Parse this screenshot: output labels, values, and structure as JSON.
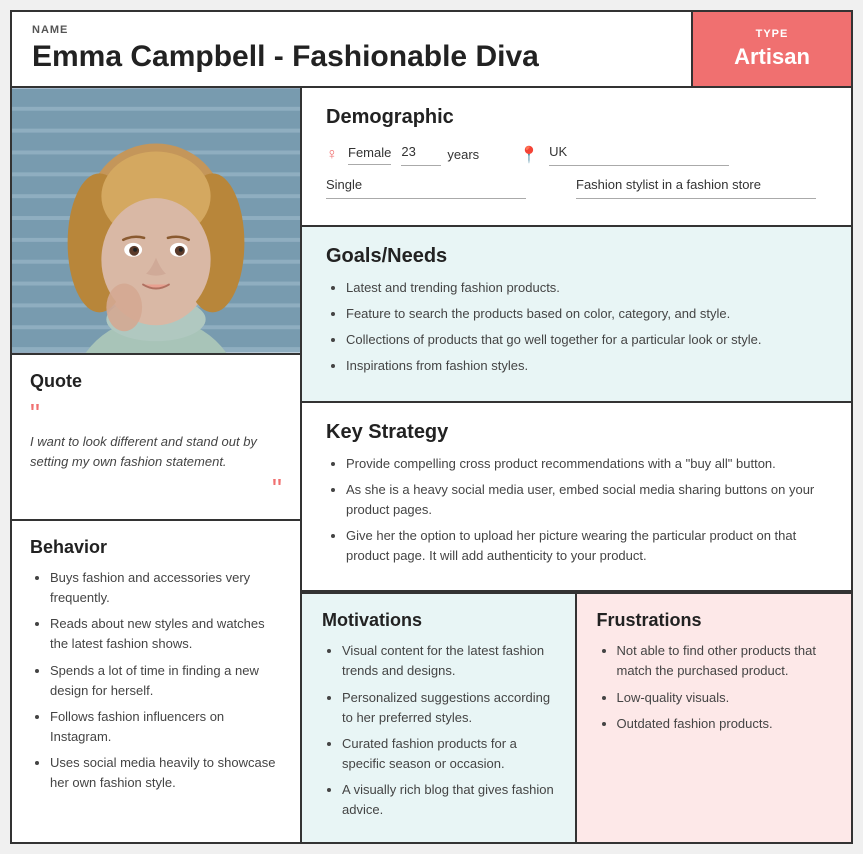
{
  "header": {
    "name_label": "NAME",
    "name": "Emma Campbell - Fashionable Diva",
    "type_label": "TYPE",
    "type_value": "Artisan"
  },
  "demographic": {
    "title": "Demographic",
    "gender": "Female",
    "age": "23",
    "age_unit": "years",
    "location": "UK",
    "status": "Single",
    "occupation": "Fashion stylist in a fashion store"
  },
  "quote": {
    "title": "Quote",
    "text": "I want to look different and stand out by setting my own fashion statement."
  },
  "behavior": {
    "title": "Behavior",
    "items": [
      "Buys fashion and accessories very frequently.",
      "Reads about new styles and watches the latest fashion shows.",
      "Spends a lot of time in finding a new design for herself.",
      "Follows fashion influencers on Instagram.",
      "Uses social media heavily to showcase her own fashion style."
    ]
  },
  "goals": {
    "title": "Goals/Needs",
    "items": [
      "Latest and trending fashion products.",
      "Feature to search the products based on color, category, and style.",
      "Collections of products that go well together for a particular look or style.",
      "Inspirations from fashion styles."
    ]
  },
  "key_strategy": {
    "title": "Key Strategy",
    "items": [
      "Provide compelling cross product recommendations with a \"buy all\" button.",
      "As she is a heavy social media user, embed social media sharing buttons on your product pages.",
      "Give her the option to upload her picture wearing the particular product on that product page. It will add authenticity to your product."
    ]
  },
  "motivations": {
    "title": "Motivations",
    "items": [
      "Visual content for the latest fashion trends and designs.",
      "Personalized suggestions according to her preferred styles.",
      "Curated fashion products for a specific season or occasion.",
      "A visually rich blog that gives fashion advice."
    ]
  },
  "frustrations": {
    "title": "Frustrations",
    "items": [
      "Not able to find other products that match the purchased product.",
      "Low-quality visuals.",
      "Outdated fashion products."
    ]
  },
  "icons": {
    "gender_icon": "♀",
    "location_icon": "📍",
    "quote_open": "“",
    "quote_close": "”"
  }
}
